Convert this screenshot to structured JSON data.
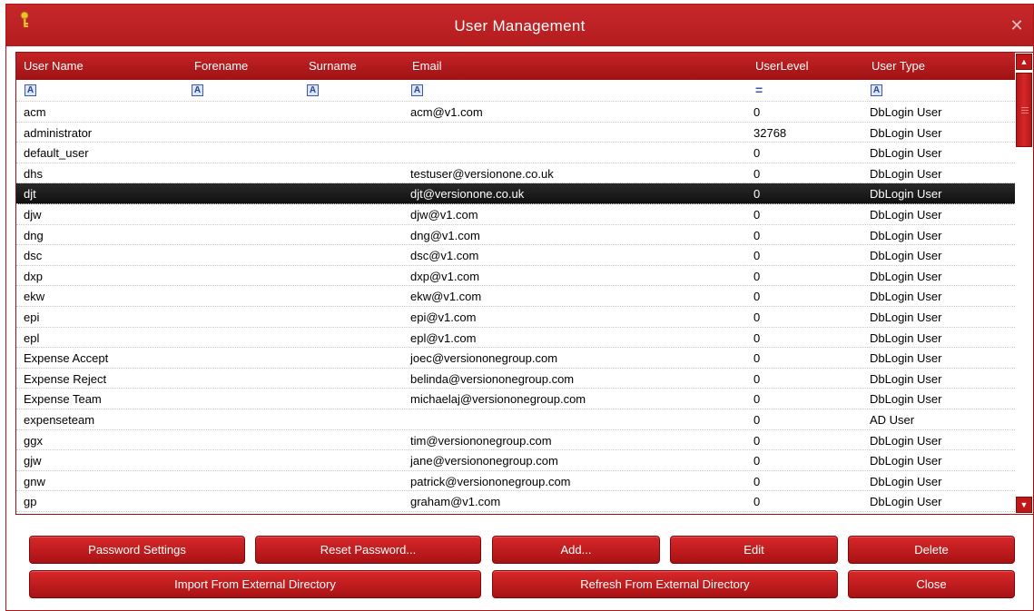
{
  "window": {
    "title": "User Management"
  },
  "grid": {
    "columns": [
      "User Name",
      "Forename",
      "Surname",
      "Email",
      "UserLevel",
      "User Type"
    ],
    "filter_eq": "=",
    "rows": [
      {
        "user": "acm",
        "fore": "",
        "sur": "",
        "email": "acm@v1.com",
        "level": "0",
        "type": "DbLogin User"
      },
      {
        "user": "administrator",
        "fore": "",
        "sur": "",
        "email": "",
        "level": "32768",
        "type": "DbLogin User"
      },
      {
        "user": "default_user",
        "fore": "",
        "sur": "",
        "email": "",
        "level": "0",
        "type": "DbLogin User"
      },
      {
        "user": "dhs",
        "fore": "",
        "sur": "",
        "email": "testuser@versionone.co.uk",
        "level": "0",
        "type": "DbLogin User"
      },
      {
        "user": "djt",
        "fore": "",
        "sur": "",
        "email": "djt@versionone.co.uk",
        "level": "0",
        "type": "DbLogin User",
        "selected": true
      },
      {
        "user": "djw",
        "fore": "",
        "sur": "",
        "email": "djw@v1.com",
        "level": "0",
        "type": "DbLogin User"
      },
      {
        "user": "dng",
        "fore": "",
        "sur": "",
        "email": "dng@v1.com",
        "level": "0",
        "type": "DbLogin User"
      },
      {
        "user": "dsc",
        "fore": "",
        "sur": "",
        "email": "dsc@v1.com",
        "level": "0",
        "type": "DbLogin User"
      },
      {
        "user": "dxp",
        "fore": "",
        "sur": "",
        "email": "dxp@v1.com",
        "level": "0",
        "type": "DbLogin User"
      },
      {
        "user": "ekw",
        "fore": "",
        "sur": "",
        "email": "ekw@v1.com",
        "level": "0",
        "type": "DbLogin User"
      },
      {
        "user": "epi",
        "fore": "",
        "sur": "",
        "email": "epi@v1.com",
        "level": "0",
        "type": "DbLogin User"
      },
      {
        "user": "epl",
        "fore": "",
        "sur": "",
        "email": "epl@v1.com",
        "level": "0",
        "type": "DbLogin User"
      },
      {
        "user": "Expense Accept",
        "fore": "",
        "sur": "",
        "email": "joec@versiononegroup.com",
        "level": "0",
        "type": "DbLogin User"
      },
      {
        "user": "Expense Reject",
        "fore": "",
        "sur": "",
        "email": "belinda@versiononegroup.com",
        "level": "0",
        "type": "DbLogin User"
      },
      {
        "user": "Expense Team",
        "fore": "",
        "sur": "",
        "email": "michaelaj@versiononegroup.com",
        "level": "0",
        "type": "DbLogin User"
      },
      {
        "user": "expenseteam",
        "fore": "",
        "sur": "",
        "email": "",
        "level": "0",
        "type": "AD User"
      },
      {
        "user": "ggx",
        "fore": "",
        "sur": "",
        "email": "tim@versiononegroup.com",
        "level": "0",
        "type": "DbLogin User"
      },
      {
        "user": "gjw",
        "fore": "",
        "sur": "",
        "email": "jane@versiononegroup.com",
        "level": "0",
        "type": "DbLogin User"
      },
      {
        "user": "gnw",
        "fore": "",
        "sur": "",
        "email": "patrick@versiononegroup.com",
        "level": "0",
        "type": "DbLogin User"
      },
      {
        "user": "gp",
        "fore": "",
        "sur": "",
        "email": "graham@v1.com",
        "level": "0",
        "type": "DbLogin User"
      }
    ]
  },
  "buttons": {
    "password_settings": "Password Settings",
    "reset_password": "Reset Password...",
    "add": "Add...",
    "edit": "Edit",
    "delete": "Delete",
    "import_external": "Import From External Directory",
    "refresh_external": "Refresh From External Directory",
    "close": "Close"
  },
  "colors": {
    "accent": "#c01818",
    "selected_row": "#1a1a1a"
  },
  "icons": {
    "title": "key-icon",
    "close": "close-icon",
    "filter": "text-filter-icon"
  }
}
